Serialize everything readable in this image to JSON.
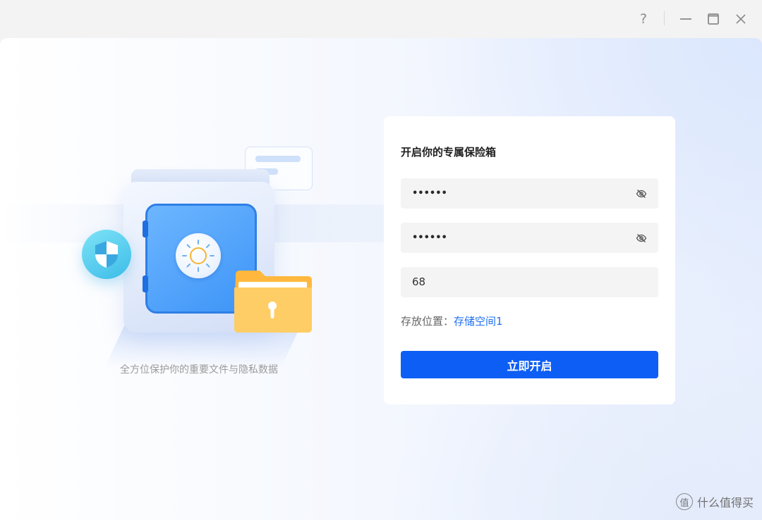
{
  "titlebar": {
    "help_label": "?",
    "icons": [
      "help-icon",
      "minimize-icon",
      "maximize-icon",
      "close-icon"
    ]
  },
  "illustration": {
    "caption": "全方位保护你的重要文件与隐私数据",
    "icons": [
      "safe-icon",
      "shield-icon",
      "folder-lock-icon",
      "note-card-icon"
    ]
  },
  "form": {
    "title": "开启你的专属保险箱",
    "password": "••••••",
    "confirm_password": "••••••",
    "hint_value": "68",
    "location_label": "存放位置：",
    "location_value": "存储空间1",
    "submit_label": "立即开启"
  },
  "watermark": {
    "text": "什么值得买",
    "badge": "值"
  },
  "colors": {
    "accent": "#0d5ef5",
    "link": "#1f6ff0",
    "safe_blue": "#3d94f7",
    "shield_cyan": "#3cbce8",
    "folder_yellow": "#ffc155"
  }
}
